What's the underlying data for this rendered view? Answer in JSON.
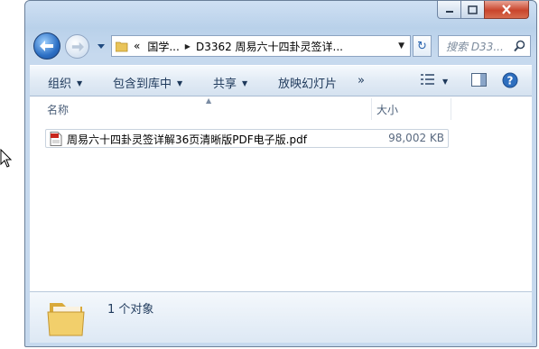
{
  "window": {
    "min_icon": "minimize-icon",
    "max_icon": "maximize-icon",
    "close_icon": "close-icon",
    "close_color": "#c9452c"
  },
  "nav": {
    "back_icon": "back-arrow-icon",
    "forward_icon": "forward-arrow-icon"
  },
  "address": {
    "overflow": "«",
    "crumb1": "国学...",
    "crumb2": "D3362 周易六十四卦灵签详..."
  },
  "search": {
    "placeholder": "搜索 D33..."
  },
  "toolbar": {
    "organize": "组织",
    "include_library": "包含到库中",
    "share": "共享",
    "slideshow": "放映幻灯片",
    "more": "»"
  },
  "columns": {
    "name": "名称",
    "size": "大小"
  },
  "files": [
    {
      "name": "周易六十四卦灵签详解36页清晰版PDF电子版.pdf",
      "size": "98,002 KB",
      "icon": "pdf-file-icon"
    }
  ],
  "details": {
    "count_text": "1 个对象"
  },
  "colors": {
    "accent": "#1e395b",
    "chrome": "#c6d9ee"
  }
}
